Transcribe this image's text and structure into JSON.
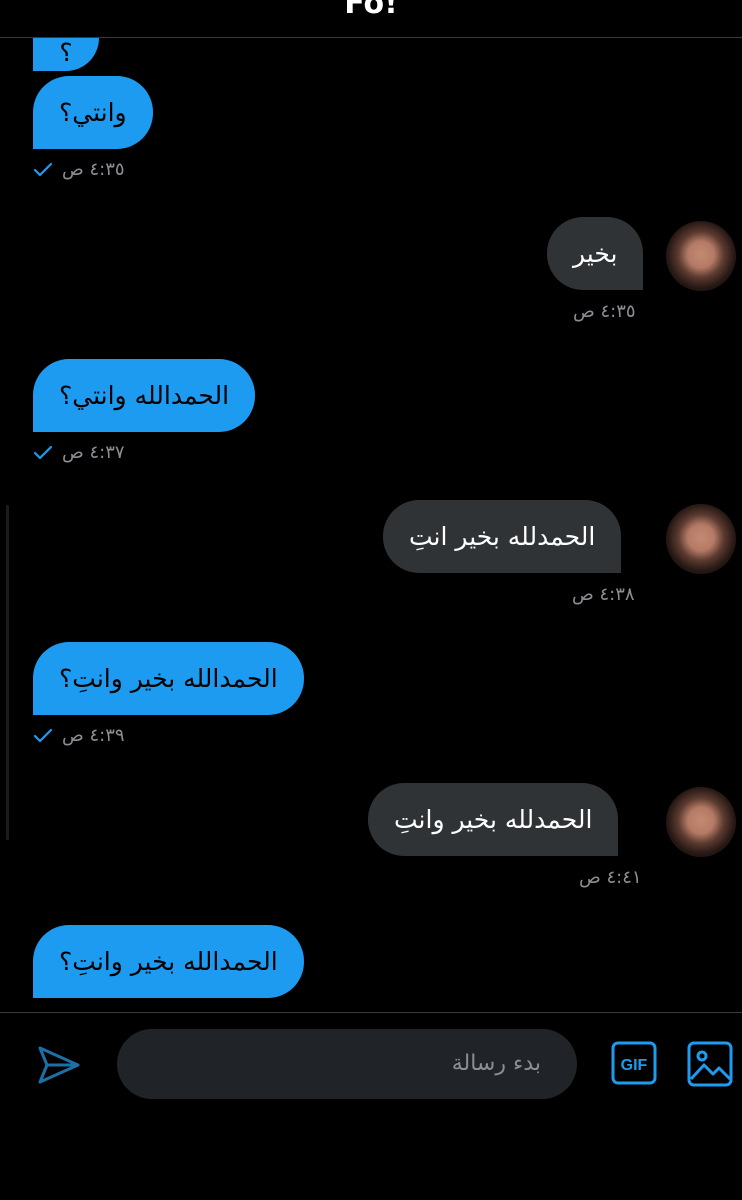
{
  "header": {
    "title": "Fo!"
  },
  "messages": [
    {
      "text": "؟",
      "side": "sent"
    },
    {
      "text": "وانتي؟",
      "side": "sent",
      "time": "٤:٣٥ ص"
    },
    {
      "text": "بخير",
      "side": "recv",
      "time": "٤:٣٥ ص"
    },
    {
      "text": "الحمدالله وانتي؟",
      "side": "sent",
      "time": "٤:٣٧ ص"
    },
    {
      "text": "الحمدلله بخير انتِ",
      "side": "recv",
      "time": "٤:٣٨ ص"
    },
    {
      "text": "الحمدالله بخير وانتِ؟",
      "side": "sent",
      "time": "٤:٣٩ ص"
    },
    {
      "text": "الحمدلله بخير وانتِ",
      "side": "recv",
      "time": "٤:٤١ ص"
    },
    {
      "text": "الحمدالله بخير وانتِ؟",
      "side": "sent"
    }
  ],
  "composer": {
    "placeholder": "بدء رسالة",
    "gif_label": "GIF",
    "send_icon": "send-icon",
    "image_icon": "image-icon"
  },
  "colors": {
    "accent": "#1d9bf0",
    "received_bubble": "#2f3336",
    "background": "#000000"
  }
}
